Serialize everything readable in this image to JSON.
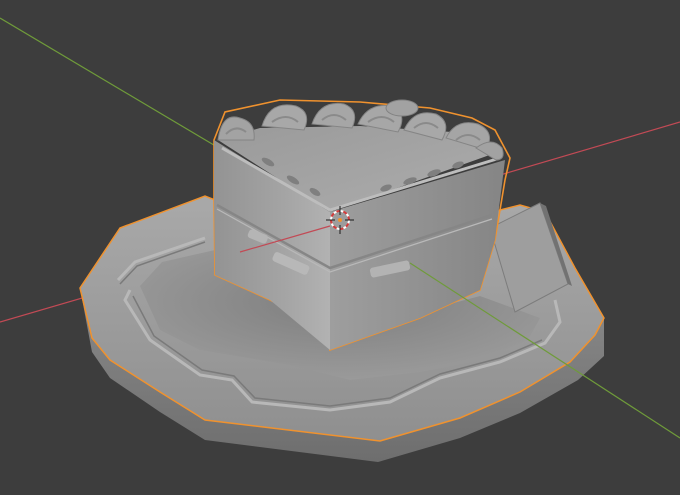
{
  "viewport": {
    "background": "#3d3d3d",
    "x_axis_color": "#c24a55",
    "y_axis_color": "#6f9b3a",
    "selection_outline_color": "#f0922e",
    "mesh_color": "#9c9c9c"
  },
  "scene": {
    "objects": [
      {
        "name_icon": "cake-slice-mesh",
        "selected": true
      },
      {
        "name_icon": "plate-mesh",
        "selected": true
      },
      {
        "name_icon": "card-tag-mesh",
        "selected": false
      }
    ],
    "cursor_icon": "3d-cursor-icon"
  }
}
